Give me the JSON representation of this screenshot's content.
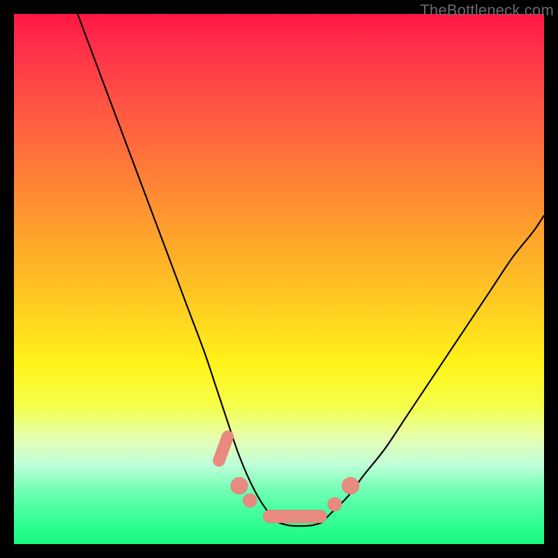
{
  "watermark": "TheBottleneck.com",
  "colors": {
    "frame": "#000000",
    "curve_stroke": "#000000",
    "marker_fill": "#e98a80",
    "marker_stroke": "#d97a72"
  },
  "chart_data": {
    "type": "line",
    "title": "",
    "xlabel": "",
    "ylabel": "",
    "xlim": [
      0,
      100
    ],
    "ylim": [
      0,
      100
    ],
    "grid": false,
    "legend": false,
    "series": [
      {
        "name": "left-branch",
        "description": "Steep descending curve from top-left toward trough",
        "x": [
          12,
          15,
          18,
          21,
          24,
          27,
          30,
          33,
          36,
          38,
          40,
          42,
          44,
          46,
          48,
          50
        ],
        "y": [
          100,
          92,
          84,
          76,
          68,
          60,
          52,
          44,
          36,
          30,
          24,
          18,
          13,
          9,
          6,
          4
        ]
      },
      {
        "name": "right-branch",
        "description": "Ascending curve from trough toward upper-right",
        "x": [
          58,
          60,
          63,
          66,
          70,
          74,
          78,
          82,
          86,
          90,
          94,
          98,
          100
        ],
        "y": [
          4,
          6,
          9,
          13,
          18,
          24,
          30,
          36,
          42,
          48,
          54,
          59,
          62
        ]
      },
      {
        "name": "trough",
        "description": "Flat minimum segment between branches",
        "x": [
          50,
          52,
          54,
          56,
          58
        ],
        "y": [
          4,
          3.5,
          3.4,
          3.5,
          4
        ]
      }
    ],
    "markers": [
      {
        "shape": "capsule",
        "cx": 39.5,
        "cy": 18,
        "w": 2.2,
        "h": 7,
        "angle_deg": 20
      },
      {
        "shape": "circle",
        "cx": 42.5,
        "cy": 11,
        "r": 1.6
      },
      {
        "shape": "circle",
        "cx": 44.5,
        "cy": 8.2,
        "r": 1.3
      },
      {
        "shape": "capsule",
        "cx": 53,
        "cy": 5.2,
        "w": 12,
        "h": 2.4,
        "angle_deg": 0
      },
      {
        "shape": "circle",
        "cx": 60.5,
        "cy": 7.5,
        "r": 1.3
      },
      {
        "shape": "circle",
        "cx": 63.5,
        "cy": 11,
        "r": 1.6
      }
    ],
    "annotations": []
  }
}
